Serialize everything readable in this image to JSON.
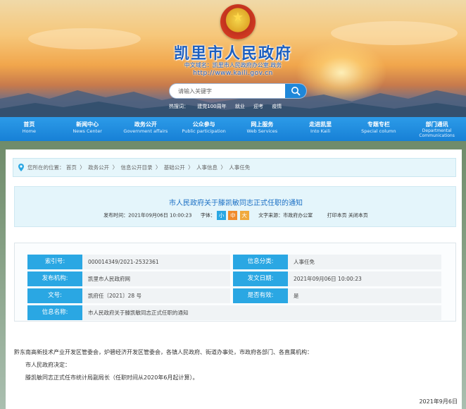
{
  "site": {
    "title": "凯里市人民政府",
    "cn_domain": "中文域名：凯里市人民政府办公室.政务",
    "url": "http://www.kaili.gov.cn"
  },
  "search": {
    "placeholder": "请输入关键字",
    "hot_label": "热搜词：",
    "hot_words": [
      "建党100周年",
      "就业",
      "迎考",
      "疫情"
    ]
  },
  "nav": [
    {
      "cn": "首页",
      "en": "Home"
    },
    {
      "cn": "新闻中心",
      "en": "News Center"
    },
    {
      "cn": "政务公开",
      "en": "Government affairs"
    },
    {
      "cn": "公众参与",
      "en": "Public participation"
    },
    {
      "cn": "网上服务",
      "en": "Web Services"
    },
    {
      "cn": "走进凯里",
      "en": "Into Kaili"
    },
    {
      "cn": "专题专栏",
      "en": "Special column"
    },
    {
      "cn": "部门通讯",
      "en": "Departmental",
      "en2": "Communications"
    }
  ],
  "breadcrumb": {
    "prefix": "您所在的位置：",
    "items": [
      "首页",
      "政务公开",
      "信息公开目录",
      "基础公开",
      "人事信息",
      "人事任免"
    ],
    "separator": "〉"
  },
  "article": {
    "title": "市人民政府关于滕凯敏同志正式任职的通知",
    "publish_label": "发布时间：",
    "publish_time": "2021年09月06日 10:00:23",
    "font_label": "字体：",
    "font_sizes": [
      "小",
      "中",
      "大"
    ],
    "source_label": "文字来源：",
    "source": "市政府办公室",
    "print_label": "打印本页",
    "close_label": "关闭本页"
  },
  "info": {
    "index_label": "索引号:",
    "index_value": "000014349/2021-2532361",
    "category_label": "信息分类:",
    "category_value": "人事任免",
    "publisher_label": "发布机构:",
    "publisher_value": "凯里市人民政府网",
    "date_label": "发文日期:",
    "date_value": "2021年09月06日 10:00:23",
    "doc_label": "文号:",
    "doc_value": "凯府任〔2021〕28 号",
    "valid_label": "是否有效:",
    "valid_value": "是",
    "name_label": "信息名称:",
    "name_value": "市人民政府关于滕凯敏同志正式任职的通知"
  },
  "body": {
    "recipients": "黔东南高新技术产业开发区管委会，炉碧经济开发区管委会，各镇人民政府、街道办事处，市政府各部门、各直属机构：",
    "decision": "市人民政府决定：",
    "content": "滕凯敏同志正式任市统计局副局长（任职时间从2020年6月起计算）。",
    "date": "2021年9月6日"
  },
  "colors": {
    "nav_blue": "#1780d6",
    "label_blue": "#2aa7e3",
    "title_blue": "#1a6fc4",
    "font_small": "#2aa7e3",
    "font_medium": "#f08a2c",
    "font_large": "#f0a93c"
  }
}
